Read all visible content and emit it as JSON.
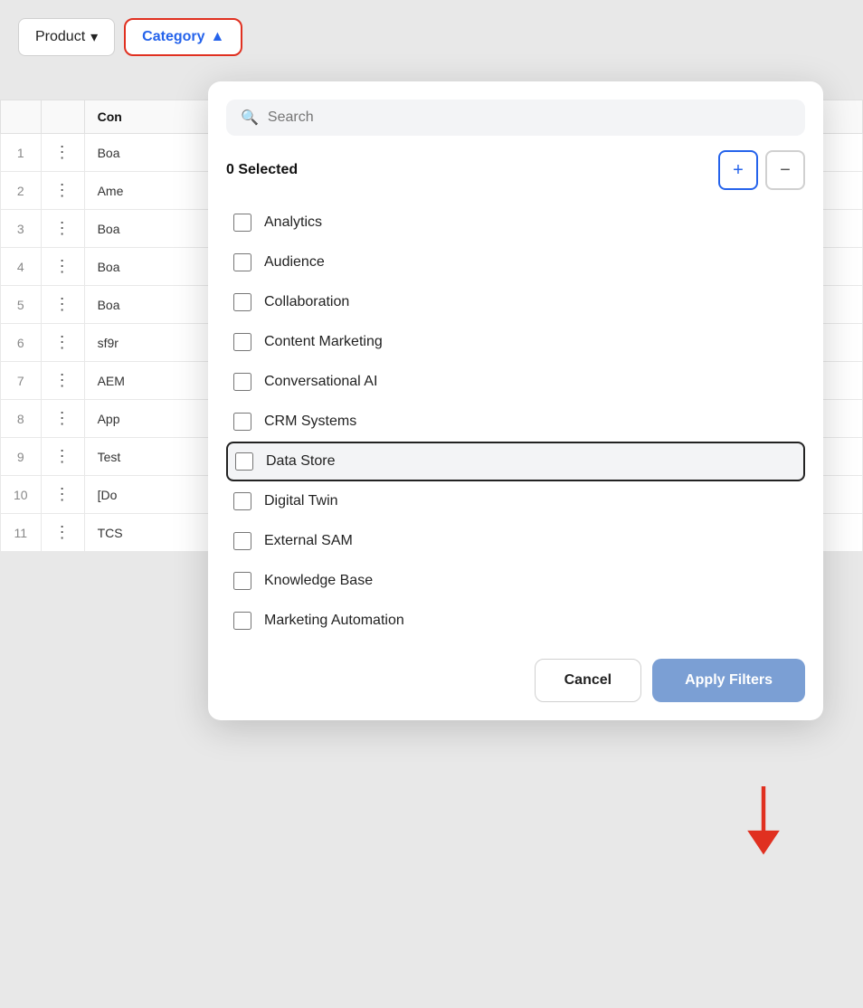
{
  "filterBar": {
    "productBtn": {
      "label": "Product",
      "chevron": "▾"
    },
    "categoryBtn": {
      "label": "Category",
      "chevron": "▲"
    }
  },
  "tableHeader": {
    "col1": "",
    "col2": "",
    "col3": "Con"
  },
  "tableRows": [
    {
      "num": "1",
      "dots": "⋮",
      "text": "Boa"
    },
    {
      "num": "2",
      "dots": "⋮",
      "text": "Ame"
    },
    {
      "num": "3",
      "dots": "⋮",
      "text": "Boa"
    },
    {
      "num": "4",
      "dots": "⋮",
      "text": "Boa"
    },
    {
      "num": "5",
      "dots": "⋮",
      "text": "Boa"
    },
    {
      "num": "6",
      "dots": "⋮",
      "text": "sf9r"
    },
    {
      "num": "7",
      "dots": "⋮",
      "text": "AEM"
    },
    {
      "num": "8",
      "dots": "⋮",
      "text": "App"
    },
    {
      "num": "9",
      "dots": "⋮",
      "text": "Test"
    },
    {
      "num": "10",
      "dots": "⋮",
      "text": "[Do"
    },
    {
      "num": "11",
      "dots": "⋮",
      "text": "TCS"
    }
  ],
  "dropdown": {
    "searchPlaceholder": "Search",
    "selectedCount": "0 Selected",
    "plusLabel": "+",
    "minusLabel": "−",
    "categories": [
      {
        "label": "Analytics",
        "checked": false,
        "highlighted": false
      },
      {
        "label": "Audience",
        "checked": false,
        "highlighted": false
      },
      {
        "label": "Collaboration",
        "checked": false,
        "highlighted": false
      },
      {
        "label": "Content Marketing",
        "checked": false,
        "highlighted": false
      },
      {
        "label": "Conversational AI",
        "checked": false,
        "highlighted": false
      },
      {
        "label": "CRM Systems",
        "checked": false,
        "highlighted": false
      },
      {
        "label": "Data Store",
        "checked": false,
        "highlighted": true
      },
      {
        "label": "Digital Twin",
        "checked": false,
        "highlighted": false
      },
      {
        "label": "External SAM",
        "checked": false,
        "highlighted": false
      },
      {
        "label": "Knowledge Base",
        "checked": false,
        "highlighted": false
      },
      {
        "label": "Marketing Automation",
        "checked": false,
        "highlighted": false
      }
    ],
    "cancelLabel": "Cancel",
    "applyLabel": "Apply Filters"
  }
}
